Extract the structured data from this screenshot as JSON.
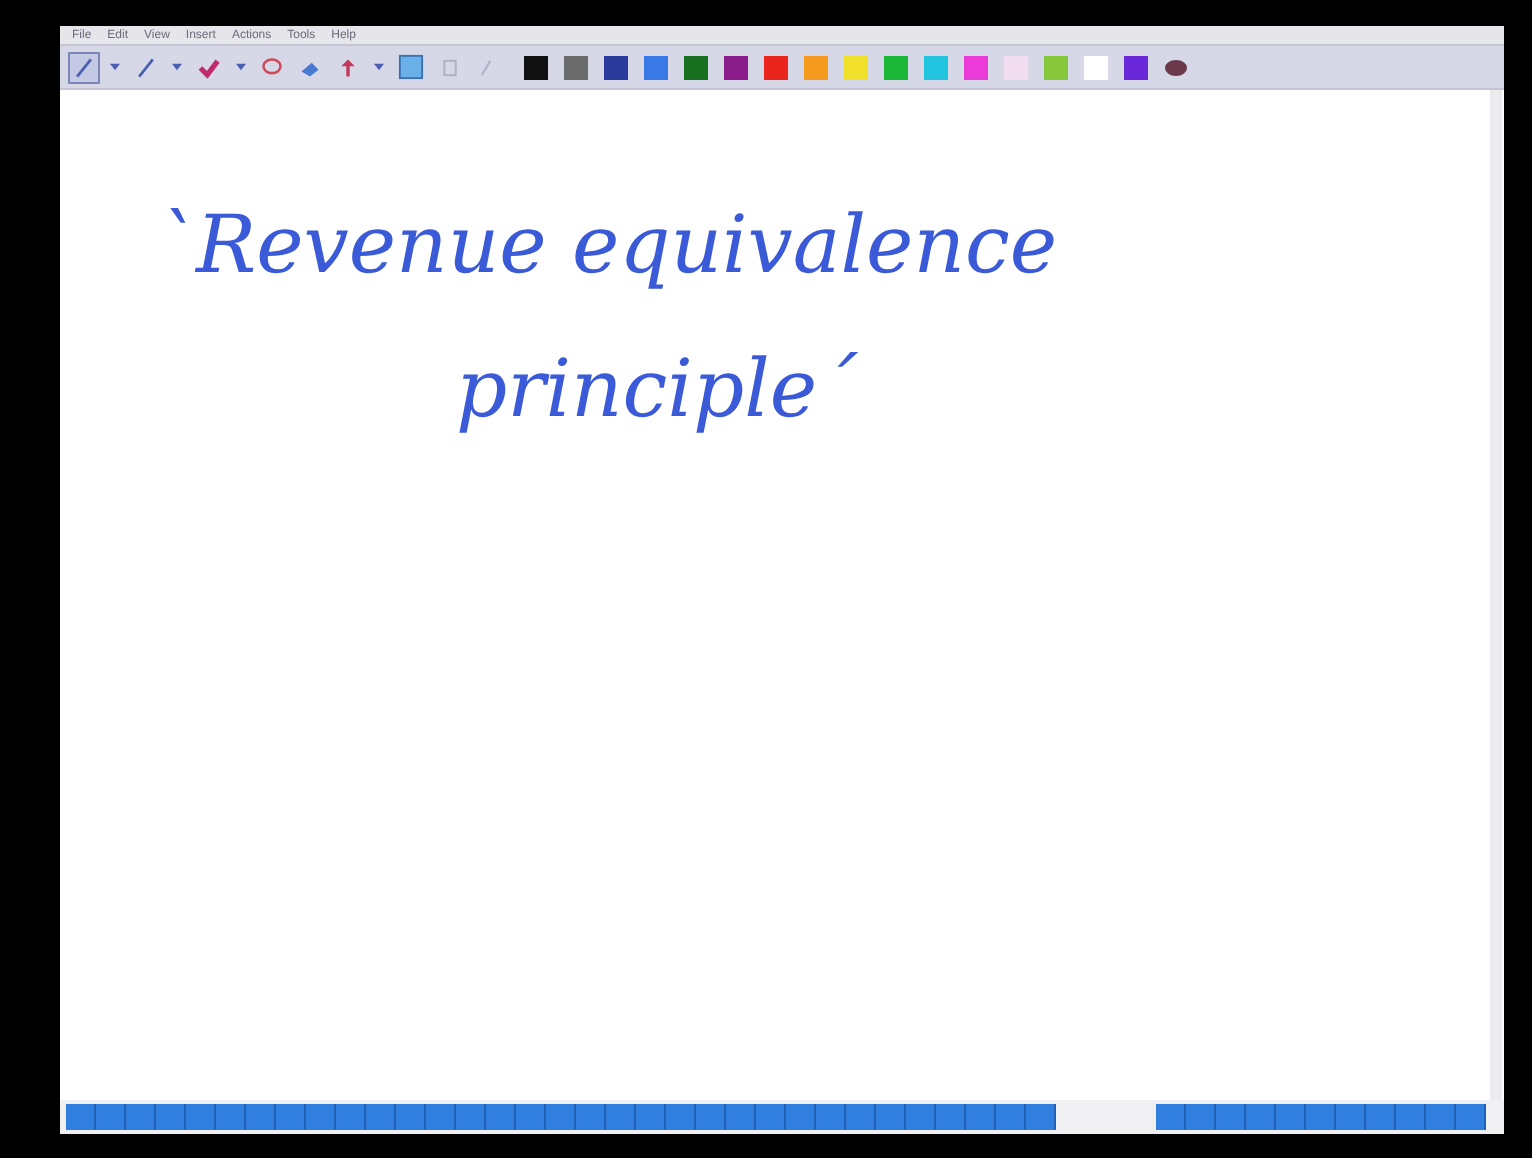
{
  "menu": [
    "File",
    "Edit",
    "View",
    "Insert",
    "Actions",
    "Tools",
    "Help"
  ],
  "tools": [
    {
      "kind": "pen",
      "selected": true
    },
    {
      "kind": "dropdown",
      "selected": false
    },
    {
      "kind": "pen",
      "selected": false
    },
    {
      "kind": "dropdown",
      "selected": false
    },
    {
      "kind": "highlighter",
      "selected": false
    },
    {
      "kind": "dropdown",
      "selected": false
    },
    {
      "kind": "lasso",
      "selected": false
    },
    {
      "kind": "eraser",
      "selected": false
    },
    {
      "kind": "hand",
      "selected": false
    },
    {
      "kind": "dropdown",
      "selected": false
    },
    {
      "kind": "page",
      "selected": false
    },
    {
      "kind": "bold",
      "selected": false
    },
    {
      "kind": "line",
      "selected": false
    }
  ],
  "swatches": [
    {
      "color": "#111111"
    },
    {
      "color": "#6b6b6b"
    },
    {
      "color": "#2a3a9c"
    },
    {
      "color": "#3a7ae8"
    },
    {
      "color": "#17701f"
    },
    {
      "color": "#8a1c8c"
    },
    {
      "color": "#e8241c"
    },
    {
      "color": "#f59a1c"
    },
    {
      "color": "#f0e02a"
    },
    {
      "color": "#1cb838"
    },
    {
      "color": "#22c4e0"
    },
    {
      "color": "#ea3ad8"
    },
    {
      "color": "#f2dcef"
    },
    {
      "color": "#86c83a"
    },
    {
      "color": "#ffffff"
    },
    {
      "color": "#6a28d8"
    }
  ],
  "note": {
    "lines": [
      "`Revenue equivalence",
      "principle´"
    ]
  }
}
